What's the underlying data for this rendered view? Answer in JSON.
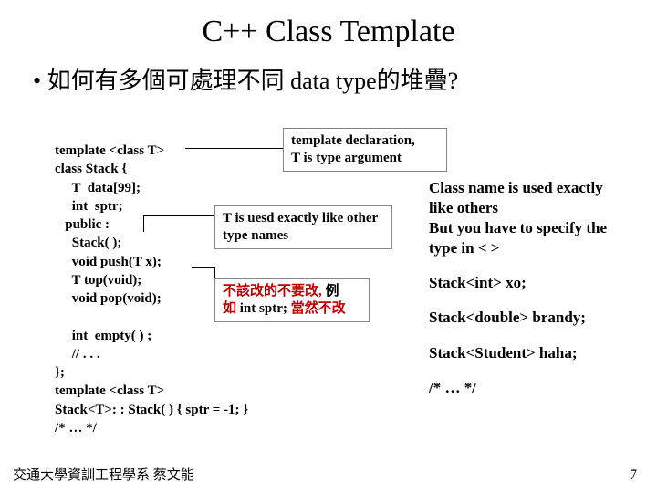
{
  "title": "C++ Class Template",
  "bullet": "• 如何有多個可處理不同 data type的堆疊?",
  "code": "template <class T>\nclass Stack {\n     T  data[99];\n     int  sptr;\n   public :\n     Stack( );\n     void push(T x);\n     T top(void);\n     void pop(void);\n\n     int  empty( ) ;\n     // . . .\n};\ntemplate <class T>\nStack<T>: : Stack( ) { sptr = -1; }\n/* … */",
  "callouts": {
    "c1": {
      "line1": "template declaration,",
      "line2": "T is type argument"
    },
    "c2": {
      "line1": "T is uesd exactly like other",
      "line2": "type names"
    },
    "c3": {
      "red1": "不該改的不要改, ",
      "norm1": "例",
      "red2": "如",
      "norm2": " int sptr; ",
      "red3": "當然不改"
    }
  },
  "right": {
    "p1": "Class name is used exactly like others",
    "p2": "But you have to specify the type in < >",
    "s1": "Stack<int> xo;",
    "s2": "Stack<double> brandy;",
    "s3": "Stack<Student> haha;",
    "s4": "/* … */"
  },
  "footer_left": "交通大學資訓工程學系 蔡文能",
  "footer_right": "7"
}
